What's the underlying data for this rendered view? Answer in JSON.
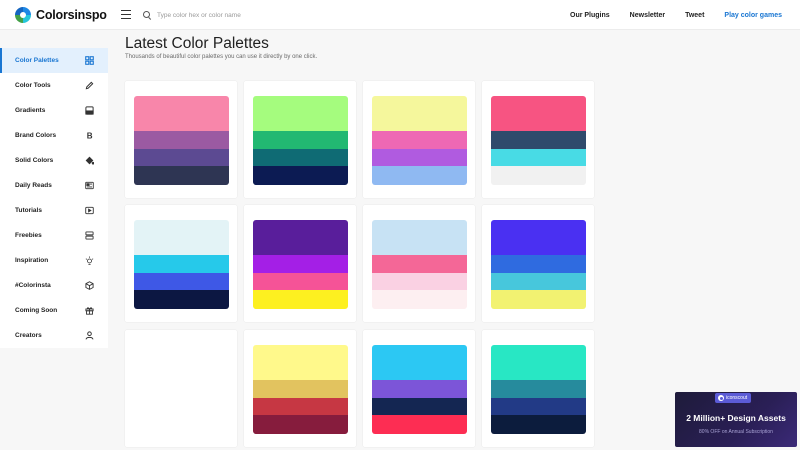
{
  "header": {
    "logo_text": "Colorsinspo",
    "search_placeholder": "Type color hex or color name",
    "nav": [
      {
        "label": "Our Plugins",
        "accent": false
      },
      {
        "label": "Newsletter",
        "accent": false
      },
      {
        "label": "Tweet",
        "accent": false
      },
      {
        "label": "Play color games",
        "accent": true
      }
    ]
  },
  "sidebar": {
    "items": [
      {
        "label": "Color Palettes",
        "icon": "grid-icon",
        "active": true
      },
      {
        "label": "Color Tools",
        "icon": "pencil-icon",
        "active": false
      },
      {
        "label": "Gradients",
        "icon": "gradient-icon",
        "active": false
      },
      {
        "label": "Brand Colors",
        "icon": "bold-b-icon",
        "active": false
      },
      {
        "label": "Solid Colors",
        "icon": "paint-bucket-icon",
        "active": false
      },
      {
        "label": "Daily Reads",
        "icon": "newspaper-icon",
        "active": false
      },
      {
        "label": "Tutorials",
        "icon": "play-icon",
        "active": false
      },
      {
        "label": "Freebies",
        "icon": "stack-icon",
        "active": false
      },
      {
        "label": "Inspiration",
        "icon": "sun-icon",
        "active": false
      },
      {
        "label": "#Colorinsta",
        "icon": "cube-icon",
        "active": false
      },
      {
        "label": "Coming Soon",
        "icon": "gift-icon",
        "active": false
      },
      {
        "label": "Creators",
        "icon": "user-icon",
        "active": false
      }
    ]
  },
  "main": {
    "title": "Latest Color Palettes",
    "subtitle": "Thousands of beautiful color palettes you can use it directly by one click.",
    "palettes": [
      {
        "colors": [
          "#f886aa",
          "#9b5aa2",
          "#5c4a92",
          "#2e3553"
        ],
        "ratios": [
          0.39,
          0.2,
          0.2,
          0.21
        ]
      },
      {
        "colors": [
          "#a5fc7e",
          "#22b872",
          "#0f6b74",
          "#0c1b53"
        ],
        "ratios": [
          0.39,
          0.2,
          0.2,
          0.21
        ]
      },
      {
        "colors": [
          "#f5f79c",
          "#ee68b4",
          "#b05be0",
          "#8fb9f2"
        ],
        "ratios": [
          0.39,
          0.2,
          0.2,
          0.21
        ]
      },
      {
        "colors": [
          "#f75482",
          "#2f4b6c",
          "#48dbe5",
          "#f1f1f1"
        ],
        "ratios": [
          0.39,
          0.2,
          0.2,
          0.21
        ]
      },
      {
        "colors": [
          "#e3f3f6",
          "#26c9ea",
          "#3e58e6",
          "#0c1742"
        ],
        "ratios": [
          0.39,
          0.2,
          0.2,
          0.21
        ]
      },
      {
        "colors": [
          "#591e9b",
          "#a41fe6",
          "#f55397",
          "#fdf020"
        ],
        "ratios": [
          0.39,
          0.2,
          0.2,
          0.21
        ]
      },
      {
        "colors": [
          "#c7e2f4",
          "#f46797",
          "#fad1e3",
          "#fdeff1"
        ],
        "ratios": [
          0.39,
          0.2,
          0.2,
          0.21
        ]
      },
      {
        "colors": [
          "#4a30f2",
          "#2f6be0",
          "#47c7dc",
          "#f2f271"
        ],
        "ratios": [
          0.39,
          0.2,
          0.2,
          0.21
        ]
      },
      {
        "colors": [],
        "ratios": []
      },
      {
        "colors": [
          "#fff98b",
          "#e2c35f",
          "#c63743",
          "#861c3d"
        ],
        "ratios": [
          0.39,
          0.2,
          0.2,
          0.21
        ]
      },
      {
        "colors": [
          "#2cc8f3",
          "#7c55d8",
          "#142652",
          "#fd2d53"
        ],
        "ratios": [
          0.39,
          0.2,
          0.2,
          0.21
        ]
      },
      {
        "colors": [
          "#28e7c4",
          "#268b9d",
          "#223a86",
          "#0c1c3d"
        ],
        "ratios": [
          0.39,
          0.2,
          0.2,
          0.21
        ]
      }
    ]
  },
  "ad": {
    "badge": "iconscout",
    "title": "2 Million+ Design Assets",
    "subtitle": "80% OFF on Annual Subscription"
  }
}
